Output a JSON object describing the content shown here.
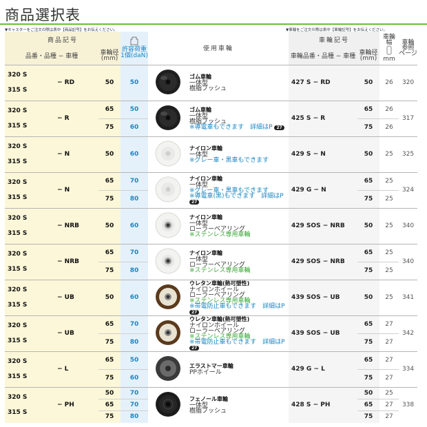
{
  "page": {
    "title": "商品選択表",
    "note_left": "▼キャスターをご注文の際は表中【商品記号】をお伝えください。",
    "note_right": "▼車輪をご注文の際は表中【車輪記号】をお伝えください。"
  },
  "header": {
    "product_code": "商品記号",
    "product_sub": "品番・品種 − 車種",
    "wheel_dia": "車輪径",
    "wheel_dia_unit": "(mm)",
    "load_label": "許容荷重",
    "load_unit": "1個(daN)",
    "use_wheel": "使用車輪",
    "wheel_code": "車輪記号",
    "wheel_sub": "車輪品番・品種 − 車種",
    "wheel_width": "車輪",
    "wheel_width_2": "幅",
    "wheel_width_unit": "mm",
    "ref_page": "車輪参照ページ",
    "ref_page_1": "車輪",
    "ref_page_2": "参照",
    "ref_page_3": "ページ"
  },
  "groups": [
    {
      "codes": [
        "320 S",
        "315 S"
      ],
      "suffix": "− RD",
      "wheel_type": "black",
      "desc": [
        {
          "t": "ゴム車輪",
          "c": "wname"
        },
        {
          "t": "一体型",
          "c": ""
        },
        {
          "t": "樹脂ブッシュ",
          "c": ""
        }
      ],
      "wheel_code": "427 S",
      "wheel_suffix": "− RD",
      "page": "320",
      "rows": [
        {
          "dia": "50",
          "load": "50",
          "wdia": "50",
          "width": "26"
        }
      ]
    },
    {
      "codes": [
        "320 S",
        "315 S"
      ],
      "suffix": "− R",
      "wheel_type": "black",
      "desc": [
        {
          "t": "ゴム車輪",
          "c": "wname"
        },
        {
          "t": "一体型",
          "c": ""
        },
        {
          "t": "樹脂ブッシュ",
          "c": ""
        },
        {
          "t": "※導電車もできます　詳細はP",
          "c": "blue",
          "badge": "27"
        }
      ],
      "wheel_code": "425 S",
      "wheel_suffix": "− R",
      "page": "317",
      "rows": [
        {
          "dia": "65",
          "load": "50",
          "wdia": "65",
          "width": "26"
        },
        {
          "dia": "75",
          "load": "60",
          "wdia": "75",
          "width": "26"
        }
      ]
    },
    {
      "codes": [
        "320 S",
        "315 S"
      ],
      "suffix": "− N",
      "wheel_type": "white",
      "desc": [
        {
          "t": "ナイロン車輪",
          "c": "wname"
        },
        {
          "t": "一体型",
          "c": ""
        },
        {
          "t": "※グレー車・黒車もできます",
          "c": "blue"
        }
      ],
      "wheel_code": "429 S",
      "wheel_suffix": "− N",
      "page": "325",
      "rows": [
        {
          "dia": "50",
          "load": "60",
          "wdia": "50",
          "width": "25"
        }
      ]
    },
    {
      "codes": [
        "320 S",
        "315 S"
      ],
      "suffix": "− N",
      "wheel_type": "white",
      "desc": [
        {
          "t": "ナイロン車輪",
          "c": "wname"
        },
        {
          "t": "一体型",
          "c": ""
        },
        {
          "t": "※グレー車・黒車もできます",
          "c": "blue"
        },
        {
          "t": "※導電車(黒)もできます　詳細はP",
          "c": "blue",
          "badge": "27"
        }
      ],
      "wheel_code": "429 G",
      "wheel_suffix": "− N",
      "page": "324",
      "rows": [
        {
          "dia": "65",
          "load": "70",
          "wdia": "65",
          "width": "25"
        },
        {
          "dia": "75",
          "load": "80",
          "wdia": "75",
          "width": "25"
        }
      ]
    },
    {
      "codes": [
        "320 S",
        "315 S"
      ],
      "suffix": "− NRB",
      "wheel_type": "white-bearing",
      "desc": [
        {
          "t": "ナイロン車輪",
          "c": "wname"
        },
        {
          "t": "一体型",
          "c": ""
        },
        {
          "t": "ローラーベアリング",
          "c": ""
        },
        {
          "t": "※ステンレス専用車輪",
          "c": "green"
        }
      ],
      "wheel_code": "429 SOS",
      "wheel_suffix": "− NRB",
      "page": "340",
      "rows": [
        {
          "dia": "50",
          "load": "60",
          "wdia": "50",
          "width": "25"
        }
      ]
    },
    {
      "codes": [
        "320 S",
        "315 S"
      ],
      "suffix": "− NRB",
      "wheel_type": "white-bearing",
      "desc": [
        {
          "t": "ナイロン車輪",
          "c": "wname"
        },
        {
          "t": "一体型",
          "c": ""
        },
        {
          "t": "ローラーベアリング",
          "c": ""
        },
        {
          "t": "※ステンレス専用車輪",
          "c": "green"
        }
      ],
      "wheel_code": "429 SOS",
      "wheel_suffix": "− NRB",
      "page": "340",
      "rows": [
        {
          "dia": "65",
          "load": "70",
          "wdia": "65",
          "width": "25"
        },
        {
          "dia": "75",
          "load": "80",
          "wdia": "75",
          "width": "25"
        }
      ]
    },
    {
      "codes": [
        "320 S",
        "315 S"
      ],
      "suffix": "− UB",
      "wheel_type": "brown",
      "desc": [
        {
          "t": "ウレタン車輪(熱可塑性)",
          "c": "wname"
        },
        {
          "t": "ナイロンホイール",
          "c": ""
        },
        {
          "t": "ローラーベアリング",
          "c": ""
        },
        {
          "t": "※ステンレス専用車輪",
          "c": "green"
        },
        {
          "t": "※帯電防止車もできます　詳細はP",
          "c": "blue",
          "badge": "27"
        }
      ],
      "wheel_code": "439 SOS",
      "wheel_suffix": "− UB",
      "page": "341",
      "rows": [
        {
          "dia": "50",
          "load": "60",
          "wdia": "50",
          "width": "25"
        }
      ]
    },
    {
      "codes": [
        "320 S",
        "315 S"
      ],
      "suffix": "− UB",
      "wheel_type": "brown",
      "desc": [
        {
          "t": "ウレタン車輪(熱可塑性)",
          "c": "wname"
        },
        {
          "t": "ナイロンホイール",
          "c": ""
        },
        {
          "t": "ローラーベアリング",
          "c": ""
        },
        {
          "t": "※ステンレス専用車輪",
          "c": "green"
        },
        {
          "t": "※帯電防止車もできます　詳細はP",
          "c": "blue",
          "badge": "27"
        }
      ],
      "wheel_code": "439 SOS",
      "wheel_suffix": "− UB",
      "page": "342",
      "rows": [
        {
          "dia": "65",
          "load": "70",
          "wdia": "65",
          "width": "27"
        },
        {
          "dia": "75",
          "load": "80",
          "wdia": "75",
          "width": "27"
        }
      ]
    },
    {
      "codes": [
        "320 S",
        "315 S"
      ],
      "suffix": "− L",
      "wheel_type": "grey",
      "desc": [
        {
          "t": "エラストマー車輪",
          "c": "wname"
        },
        {
          "t": "PPホイール",
          "c": ""
        }
      ],
      "wheel_code": "429 G",
      "wheel_suffix": "− L",
      "page": "334",
      "rows": [
        {
          "dia": "65",
          "load": "50",
          "wdia": "65",
          "width": "27"
        },
        {
          "dia": "75",
          "load": "60",
          "wdia": "75",
          "width": "27"
        }
      ]
    },
    {
      "codes": [
        "320 S",
        "315 S"
      ],
      "suffix": "− PH",
      "wheel_type": "black-ph",
      "desc": [
        {
          "t": "フェノール車輪",
          "c": "wname"
        },
        {
          "t": "一体型",
          "c": ""
        },
        {
          "t": "樹脂ブッシュ",
          "c": ""
        }
      ],
      "wheel_code": "428 S",
      "wheel_suffix": "− PH",
      "page": "338",
      "rows": [
        {
          "dia": "50",
          "load": "70",
          "wdia": "50",
          "width": "25"
        },
        {
          "dia": "65",
          "load": "70",
          "wdia": "65",
          "width": "27"
        },
        {
          "dia": "75",
          "load": "80",
          "wdia": "75",
          "width": "27"
        }
      ]
    }
  ]
}
